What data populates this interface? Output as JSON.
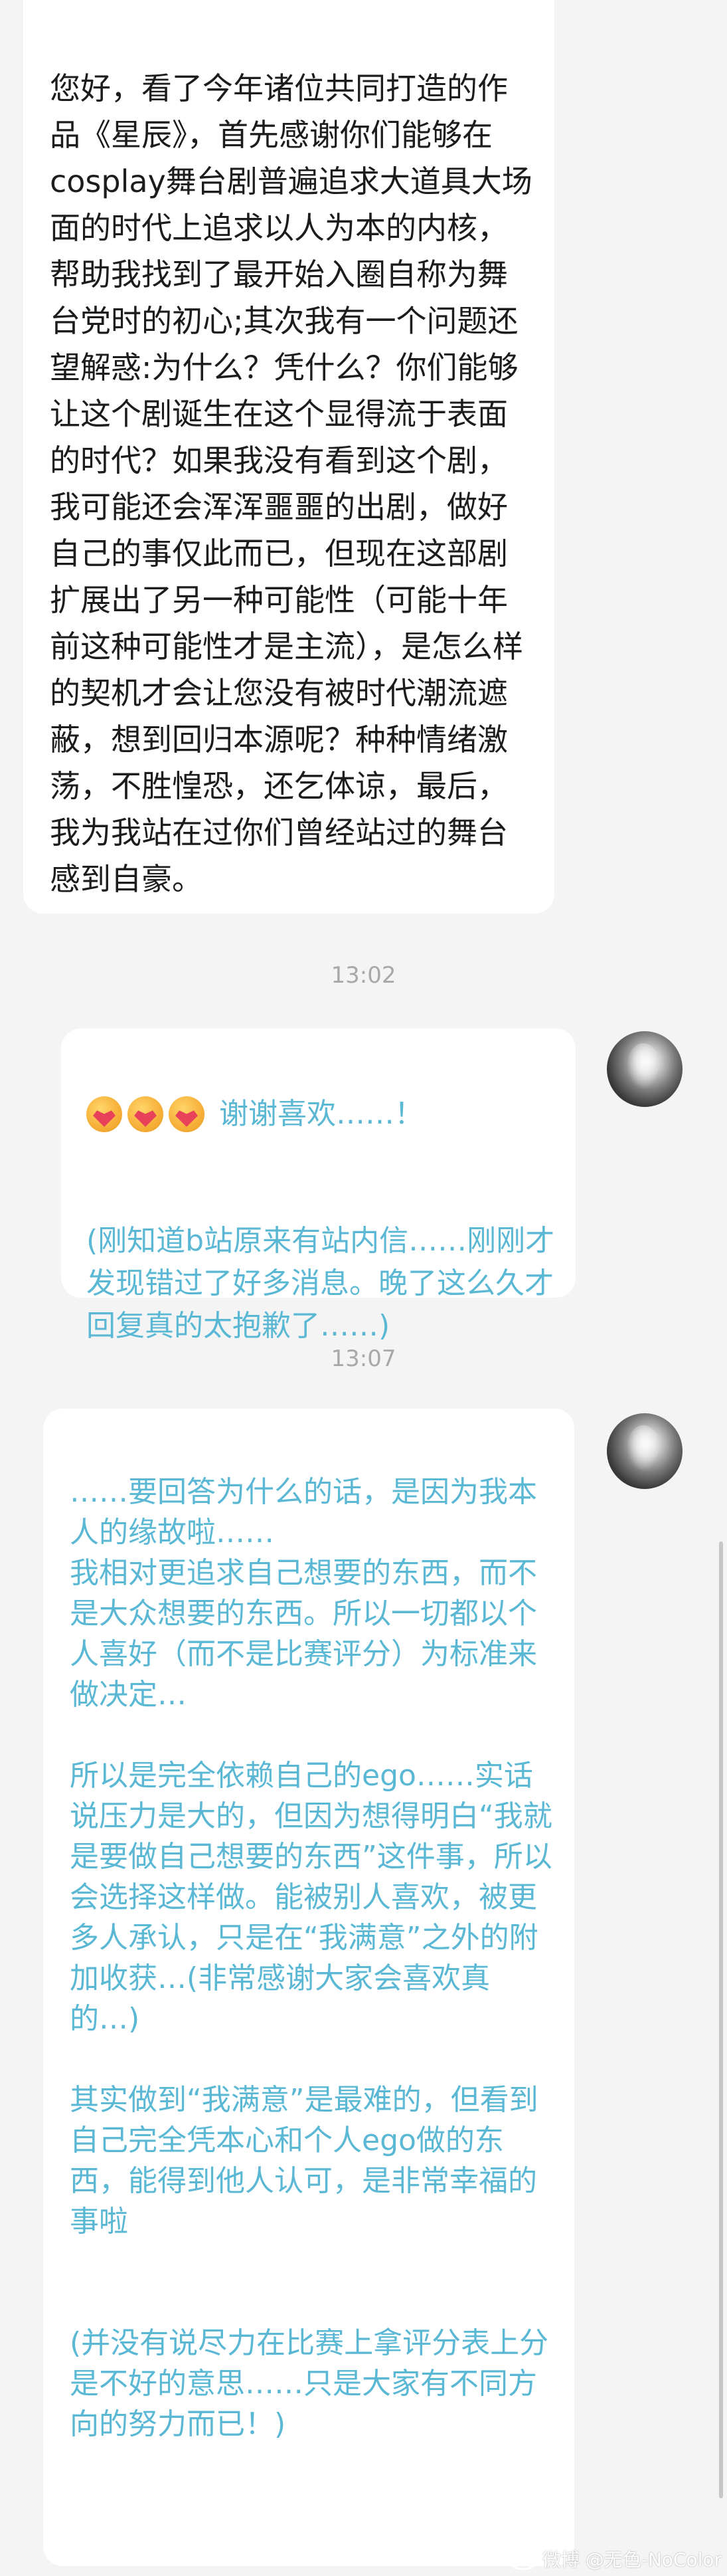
{
  "conversation": {
    "incoming_message": "您好，看了今年诸位共同打造的作品《星辰》，首先感谢你们能够在cosplay舞台剧普遍追求大道具大场面的时代上追求以人为本的内核，帮助我找到了最开始入圈自称为舞台党时的初心;其次我有一个问题还望解惑:为什么？凭什么？你们能够让这个剧诞生在这个显得流于表面的时代？如果我没有看到这个剧，我可能还会浑浑噩噩的出剧，做好自己的事仅此而已，但现在这部剧扩展出了另一种可能性（可能十年前这种可能性才是主流），是怎么样的契机才会让您没有被时代潮流遮蔽，想到回归本源呢？种种情绪激荡，不胜惶恐，还乞体谅，最后，我为我站在过你们曾经站过的舞台感到自豪。",
    "timestamp_1": "13:02",
    "reply_1": {
      "emoji": [
        "heart-face-emoji",
        "heart-face-emoji",
        "heart-face-emoji"
      ],
      "title": "谢谢喜欢……！",
      "body": "(刚知道b站原来有站内信……刚刚才发现错过了好多消息。晚了这么久才回复真的太抱歉了……)"
    },
    "timestamp_2": "13:07",
    "reply_2": "……要回答为什么的话，是因为我本人的缘故啦……\n我相对更追求自己想要的东西，而不是大众想要的东西。所以一切都以个人喜好（而不是比赛评分）为标准来做决定…\n\n所以是完全依赖自己的ego……实话说压力是大的，但因为想得明白“我就是要做自己想要的东西”这件事，所以会选择这样做。能被别人喜欢，被更多人承认，只是在“我满意”之外的附加收获…(非常感谢大家会喜欢真的…)\n\n其实做到“我满意”是最难的，但看到自己完全凭本心和个人ego做的东西，能得到他人认可，是非常幸福的事啦\n\n\n(并没有说尽力在比赛上拿评分表上分是不好的意思……只是大家有不同方向的努力而已！)"
  },
  "watermark": "微博 @无色-NoColor",
  "colors": {
    "background": "#f4f4f4",
    "bubble": "#ffffff",
    "incoming_text": "#1c1c1c",
    "reply_text": "#5ab8d4",
    "timestamp": "#a8a8a8"
  }
}
